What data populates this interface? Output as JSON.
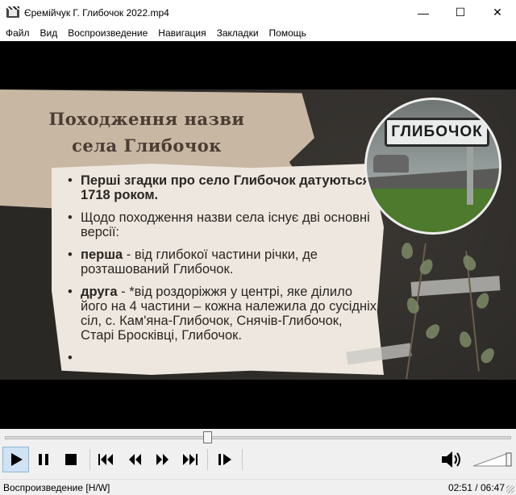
{
  "window": {
    "title": "Єремійчук Г. Глибочок 2022.mp4",
    "minimize_glyph": "—",
    "maximize_glyph": "☐",
    "close_glyph": "✕"
  },
  "menu": {
    "items": [
      "Файл",
      "Вид",
      "Воспроизведение",
      "Навигация",
      "Закладки",
      "Помощь"
    ]
  },
  "slide": {
    "title_line1": "Походження назви",
    "title_line2": "села Глибочок",
    "bullets": [
      {
        "strong": "",
        "text": "Перші згадки про село Глибочок датуються 1718 роком."
      },
      {
        "strong": "",
        "text": "Щодо походження назви села існує дві основні версії:"
      },
      {
        "strong": "перша",
        "text": " - від глибокої частини річки, де розташований Глибочок."
      },
      {
        "strong": "друга",
        "text": " - *від роздоріжжя у центрі, яке ділило його на 4 частини – кожна належила до сусідніх сіл, с. Кам'яна-Глибочок, Снячів-Глибочок, Старі Бросківці, Глибочок."
      },
      {
        "strong": "",
        "text": ""
      }
    ],
    "photo_sign": "ГЛИБОЧОК"
  },
  "player": {
    "progress": 0.4,
    "volume": 1.0,
    "buttons": {
      "play": "play-icon",
      "pause": "pause-icon",
      "stop": "stop-icon",
      "prev": "skip-back-icon",
      "rewind": "rewind-icon",
      "forward": "fast-forward-icon",
      "next": "skip-forward-icon",
      "frame_step": "frame-step-icon"
    }
  },
  "status": {
    "left": "Воспроизведение [H/W]",
    "time": "02:51 / 06:47"
  }
}
